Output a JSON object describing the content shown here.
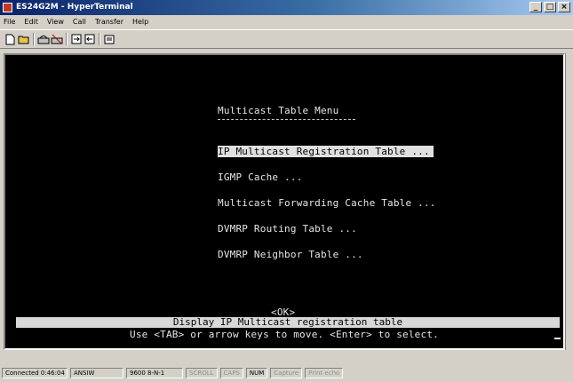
{
  "window": {
    "title": "ES24G2M - HyperTerminal",
    "controls": [
      "_",
      "□",
      "×"
    ]
  },
  "menubar": [
    "File",
    "Edit",
    "View",
    "Call",
    "Transfer",
    "Help"
  ],
  "toolbar": [
    "new-icon",
    "open-icon",
    "dial-icon",
    "disconnect-icon",
    "send-icon",
    "receive-icon",
    "properties-icon"
  ],
  "terminal": {
    "menu_title": "Multicast Table Menu",
    "items": [
      "IP Multicast Registration Table ...",
      "IGMP Cache ...",
      "Multicast Forwarding Cache Table ...",
      "DVMRP Routing Table ...",
      "DVMRP Neighbor Table ..."
    ],
    "selected_index": 0,
    "ok_label": "<OK>",
    "help_text": "Display IP Multicast registration table",
    "hint_text": "Use <TAB> or arrow keys to move. <Enter> to select."
  },
  "statusbar": {
    "connected": "Connected 0:46:04",
    "emulation": "ANSIW",
    "settings": "9600 8-N-1",
    "scroll": "SCROLL",
    "caps": "CAPS",
    "num": "NUM",
    "capture": "Capture",
    "print_echo": "Print echo"
  }
}
